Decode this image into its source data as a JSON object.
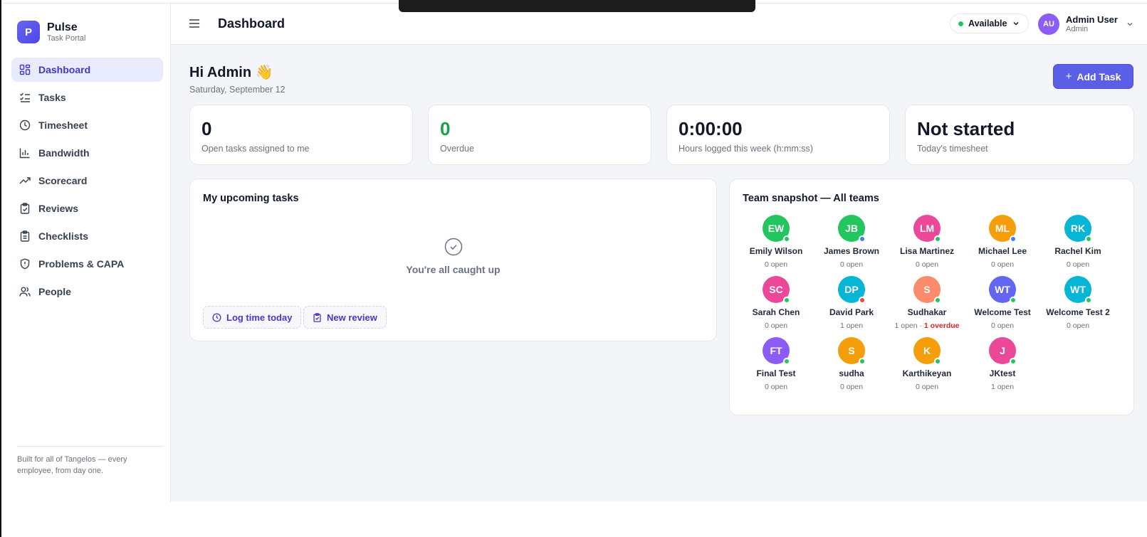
{
  "brand": {
    "initial": "P",
    "name": "Pulse",
    "subtitle": "Task Portal"
  },
  "sidebar": {
    "items": [
      {
        "label": "Dashboard",
        "icon": "dashboard-icon",
        "active": true
      },
      {
        "label": "Tasks",
        "icon": "tasks-icon"
      },
      {
        "label": "Timesheet",
        "icon": "clock-icon"
      },
      {
        "label": "Bandwidth",
        "icon": "bar-chart-icon"
      },
      {
        "label": "Scorecard",
        "icon": "trend-icon"
      },
      {
        "label": "Reviews",
        "icon": "clipboard-check-icon"
      },
      {
        "label": "Checklists",
        "icon": "clipboard-list-icon"
      },
      {
        "label": "Problems & CAPA",
        "icon": "shield-icon"
      },
      {
        "label": "People",
        "icon": "people-icon"
      }
    ],
    "footer": "Built for all of Tangelos — every employee, from day one."
  },
  "header": {
    "title": "Dashboard",
    "status": "Available",
    "user": {
      "initials": "AU",
      "name": "Admin User",
      "role": "Admin"
    }
  },
  "main": {
    "greeting": "Hi Admin 👋",
    "date": "Saturday, September 12",
    "add_task_label": "Add Task",
    "stats": [
      {
        "value": "0",
        "label": "Open tasks assigned to me"
      },
      {
        "value": "0",
        "label": "Overdue"
      },
      {
        "value": "0:00:00",
        "label": "Hours logged this week (h:mm:ss)"
      },
      {
        "value": "Not started",
        "label": "Today's timesheet"
      }
    ],
    "upcoming": {
      "title": "My upcoming tasks",
      "empty_text": "You're all caught up",
      "log_time_label": "Log time today",
      "new_review_label": "New review"
    },
    "team": {
      "title": "Team snapshot — All teams",
      "members": [
        {
          "initials": "EW",
          "name": "Emily Wilson",
          "open": "0 open",
          "color": "#22c55e",
          "status": "#22c55e"
        },
        {
          "initials": "JB",
          "name": "James Brown",
          "open": "0 open",
          "color": "#22c55e",
          "status": "#3b82f6"
        },
        {
          "initials": "LM",
          "name": "Lisa Martinez",
          "open": "0 open",
          "color": "#ec4899",
          "status": "#22c55e"
        },
        {
          "initials": "ML",
          "name": "Michael Lee",
          "open": "0 open",
          "color": "#f59e0b",
          "status": "#3b82f6"
        },
        {
          "initials": "RK",
          "name": "Rachel Kim",
          "open": "0 open",
          "color": "#06b6d4",
          "status": "#22c55e"
        },
        {
          "initials": "SC",
          "name": "Sarah Chen",
          "open": "0 open",
          "color": "#ec4899",
          "status": "#22c55e"
        },
        {
          "initials": "DP",
          "name": "David Park",
          "open": "1 open",
          "color": "#06b6d4",
          "status": "#ef4444"
        },
        {
          "initials": "S",
          "name": "Sudhakar",
          "open": "1 open · ",
          "overdue": "1 overdue",
          "color": "#fb8b6a",
          "status": "#22c55e"
        },
        {
          "initials": "WT",
          "name": "Welcome Test",
          "open": "0 open",
          "color": "#6366f1",
          "status": "#22c55e"
        },
        {
          "initials": "WT",
          "name": "Welcome Test 2",
          "open": "0 open",
          "color": "#06b6d4",
          "status": "#22c55e"
        },
        {
          "initials": "FT",
          "name": "Final Test",
          "open": "0 open",
          "color": "#8b5cf6",
          "status": "#22c55e"
        },
        {
          "initials": "S",
          "name": "sudha",
          "open": "0 open",
          "color": "#f59e0b",
          "status": "#22c55e"
        },
        {
          "initials": "K",
          "name": "Karthikeyan",
          "open": "0 open",
          "color": "#f59e0b",
          "status": "#22c55e"
        },
        {
          "initials": "J",
          "name": "JKtest",
          "open": "1 open",
          "color": "#ec4899",
          "status": "#22c55e"
        }
      ]
    }
  }
}
